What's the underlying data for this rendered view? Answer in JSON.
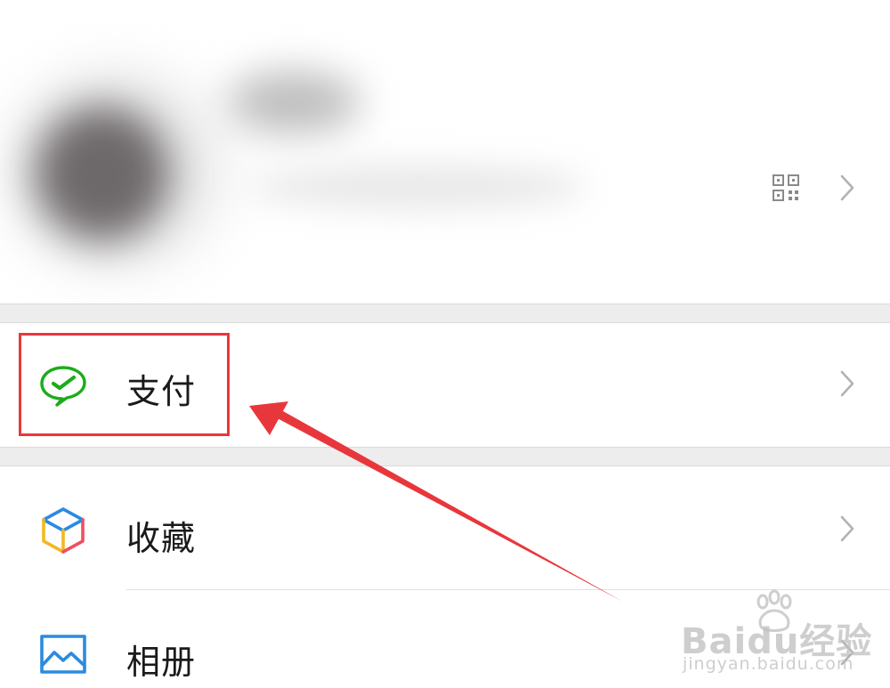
{
  "menu": {
    "pay_label": "支付",
    "favorites_label": "收藏",
    "album_label": "相册"
  },
  "watermark": {
    "brand": "Baidu经验",
    "url": "jingyan.baidu.com"
  },
  "colors": {
    "pay_icon": "#1aad19",
    "highlight": "#e8373c",
    "chevron": "#b2b2b2",
    "divider": "#ededed"
  },
  "icons": {
    "qr": "qr-code-icon",
    "chevron": "chevron-right-icon",
    "pay": "wechat-pay-icon",
    "favorites": "cube-icon",
    "album": "landscape-image-icon"
  }
}
